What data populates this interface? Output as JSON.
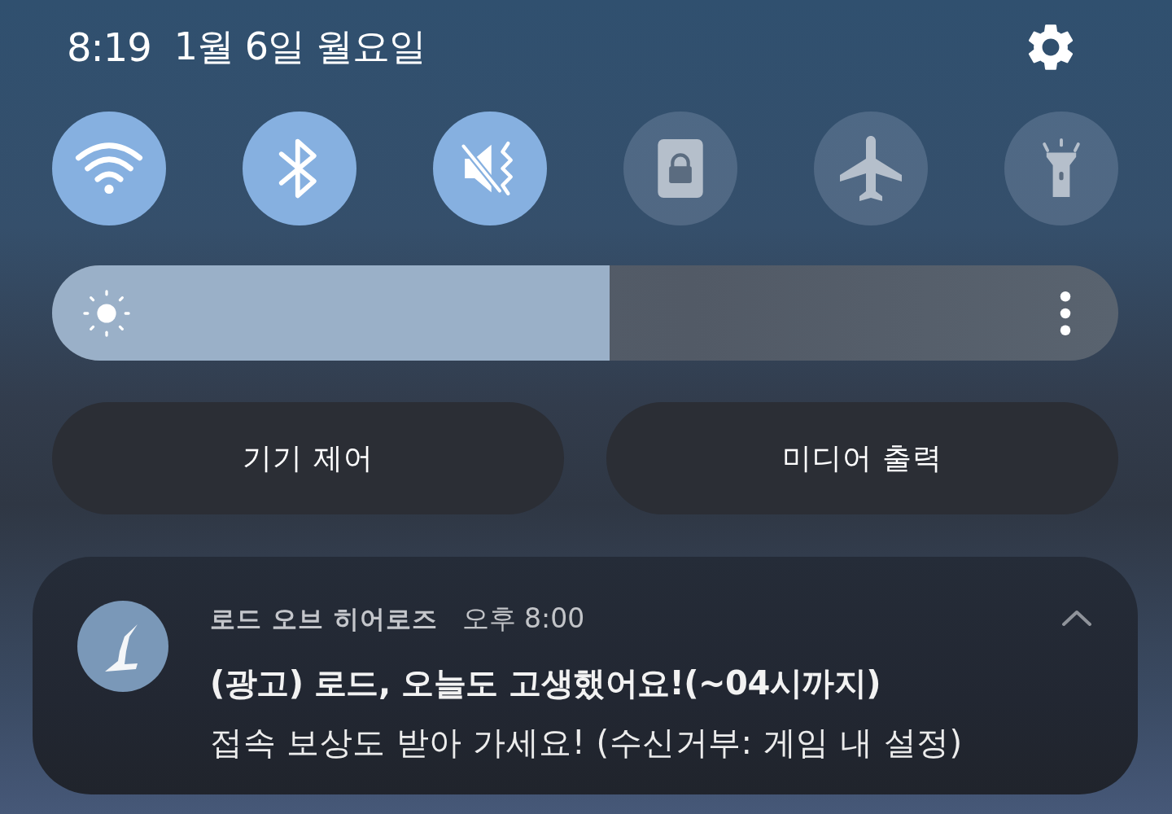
{
  "status_header": {
    "time": "8:19",
    "date": "1월 6일 월요일"
  },
  "quick_toggles": [
    {
      "kind": "wifi",
      "on": true
    },
    {
      "kind": "bluetooth",
      "on": true
    },
    {
      "kind": "mute_vibrate",
      "on": true
    },
    {
      "kind": "rotation_lock",
      "on": false
    },
    {
      "kind": "airplane",
      "on": false
    },
    {
      "kind": "flashlight",
      "on": false
    }
  ],
  "brightness": {
    "level": 0.523
  },
  "buttons": [
    "기기 제어",
    "미디어 출력"
  ],
  "notification": {
    "app_name": "로드 오브 히어로즈",
    "time": "오후 8:00",
    "title": "(광고) 로드, 오늘도 고생했어요!(~04시까지)",
    "body": "접속 보상도 받아 가세요! (수신거부: 게임 내 설정)",
    "expanded": true
  }
}
